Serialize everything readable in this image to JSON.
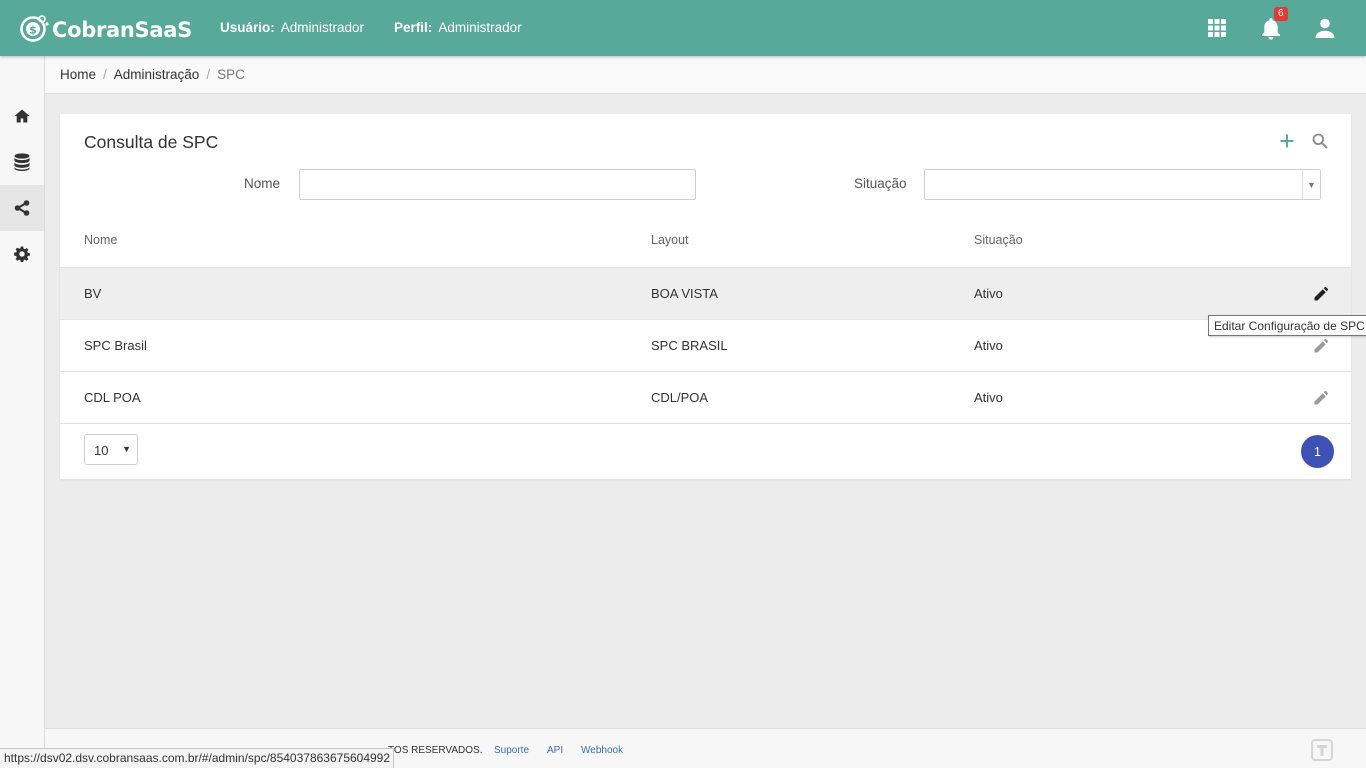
{
  "header": {
    "brand": "CobranSaaS",
    "user_label": "Usuário:",
    "user_value": "Administrador",
    "profile_label": "Perfil:",
    "profile_value": "Administrador",
    "notification_count": "6",
    "icons": [
      "apps-grid-icon",
      "bell-icon",
      "account-icon"
    ]
  },
  "sidebar": {
    "items": [
      {
        "icon": "home-icon"
      },
      {
        "icon": "database-icon"
      },
      {
        "icon": "share-icon",
        "active": true
      },
      {
        "icon": "gear-icon"
      }
    ]
  },
  "breadcrumb": {
    "items": [
      "Home",
      "Administração"
    ],
    "current": "SPC"
  },
  "card": {
    "title": "Consulta de SPC",
    "filters": {
      "name_label": "Nome",
      "name_value": "",
      "status_label": "Situação",
      "status_value": ""
    },
    "columns": [
      "Nome",
      "Layout",
      "Situação"
    ],
    "rows": [
      {
        "nome": "BV",
        "layout": "BOA VISTA",
        "situacao": "Ativo"
      },
      {
        "nome": "SPC Brasil",
        "layout": "SPC BRASIL",
        "situacao": "Ativo"
      },
      {
        "nome": "CDL POA",
        "layout": "CDL/POA",
        "situacao": "Ativo"
      }
    ],
    "page_size": "10",
    "current_page": "1"
  },
  "tooltip": "Editar Configuração de SPC",
  "footer": {
    "copyright": "TOS RESERVADOS.",
    "links": [
      "Suporte",
      "API",
      "Webhook"
    ]
  },
  "status_url": "https://dsv02.dsv.cobransaas.com.br/#/admin/spc/854037863675604992",
  "colors": {
    "header": "#57a99a",
    "accent": "#3f51b5",
    "badge": "#e53935"
  }
}
